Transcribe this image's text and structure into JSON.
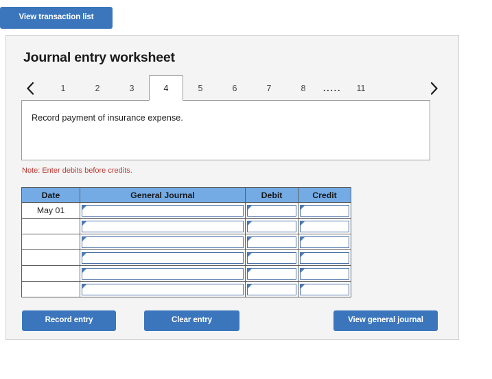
{
  "toolbar": {
    "view_transaction_list_label": "View transaction list"
  },
  "panel": {
    "title": "Journal entry worksheet",
    "prev_icon": "chevron-left-icon",
    "next_icon": "chevron-right-icon",
    "tabs": [
      {
        "label": "1",
        "active": false
      },
      {
        "label": "2",
        "active": false
      },
      {
        "label": "3",
        "active": false
      },
      {
        "label": "4",
        "active": true
      },
      {
        "label": "5",
        "active": false
      },
      {
        "label": "6",
        "active": false
      },
      {
        "label": "7",
        "active": false
      },
      {
        "label": "8",
        "active": false
      },
      {
        "label": ".....",
        "active": false
      },
      {
        "label": "11",
        "active": false
      }
    ],
    "description": "Record payment of insurance expense.",
    "note": "Note: Enter debits before credits."
  },
  "journal": {
    "headers": [
      "Date",
      "General Journal",
      "Debit",
      "Credit"
    ],
    "rows": [
      {
        "date": "May 01",
        "general_journal": "",
        "debit": "",
        "credit": ""
      },
      {
        "date": "",
        "general_journal": "",
        "debit": "",
        "credit": ""
      },
      {
        "date": "",
        "general_journal": "",
        "debit": "",
        "credit": ""
      },
      {
        "date": "",
        "general_journal": "",
        "debit": "",
        "credit": ""
      },
      {
        "date": "",
        "general_journal": "",
        "debit": "",
        "credit": ""
      },
      {
        "date": "",
        "general_journal": "",
        "debit": "",
        "credit": ""
      }
    ]
  },
  "actions": {
    "record_entry_label": "Record entry",
    "clear_entry_label": "Clear entry",
    "view_general_journal_label": "View general journal"
  },
  "colors": {
    "button_blue": "#3b76bd",
    "table_header_blue": "#74abe5",
    "note_red": "#bb3a34",
    "panel_background": "#f4f4f4",
    "input_border_blue": "#4a72a8"
  }
}
